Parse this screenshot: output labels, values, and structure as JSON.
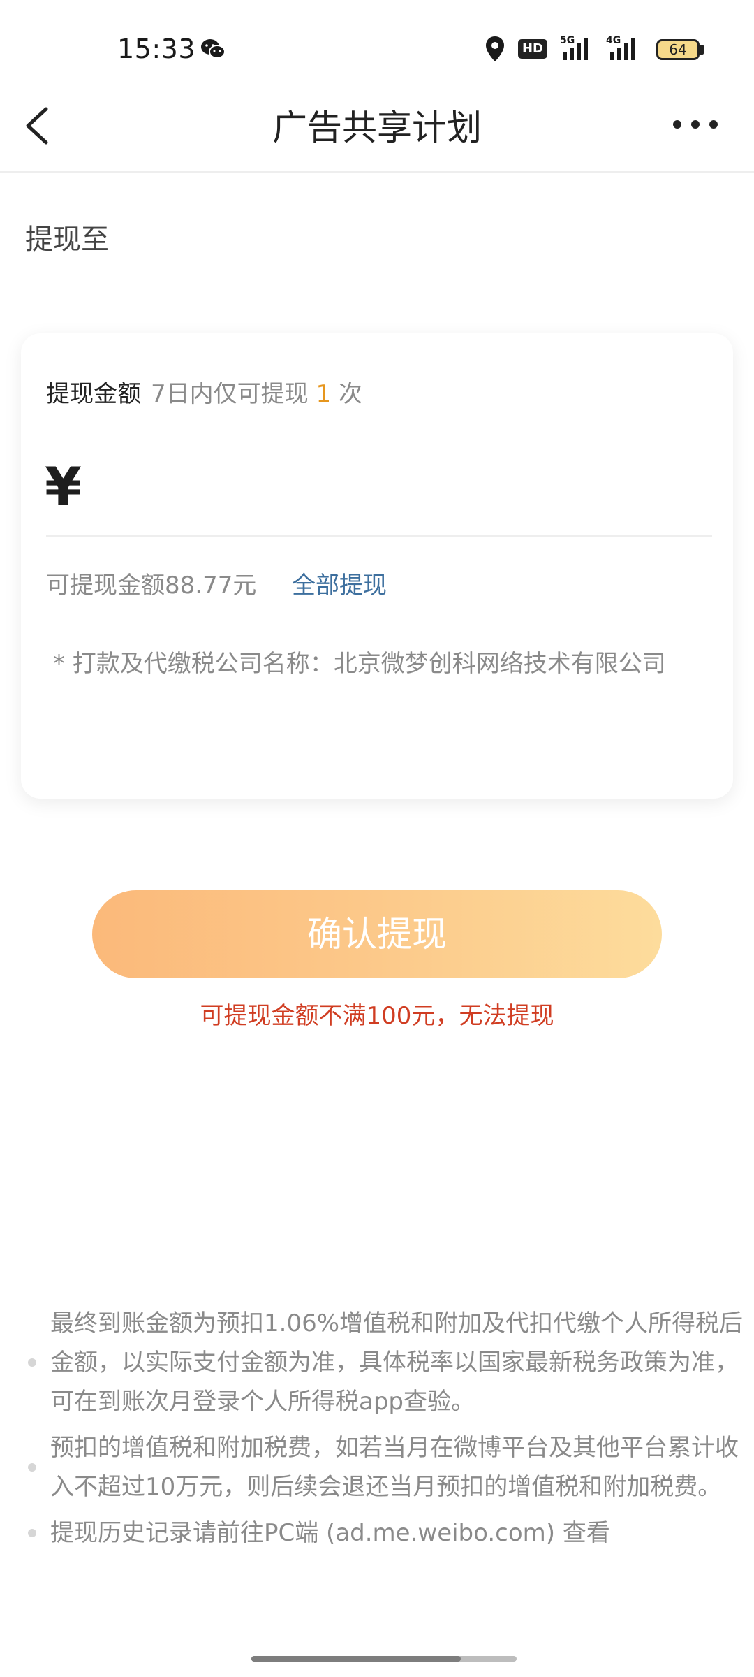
{
  "status_bar": {
    "time": "15:33",
    "hd_label": "HD",
    "signal1_label": "5G",
    "signal2_label": "4G",
    "battery": "64"
  },
  "nav": {
    "title": "广告共享计划"
  },
  "withdraw_to_label": "提现至",
  "card": {
    "amount_label": "提现金额",
    "limit_prefix": "7日内仅可提现",
    "limit_count": "1",
    "limit_suffix": "次",
    "currency_symbol": "¥",
    "available_text": "可提现金额88.77元",
    "withdraw_all": "全部提现",
    "company_note": "* 打款及代缴税公司名称：北京微梦创科网络技术有限公司"
  },
  "confirm_button": "确认提现",
  "error_text": "可提现金额不满100元，无法提现",
  "notes": [
    "最终到账金额为预扣1.06%增值税和附加及代扣代缴个人所得税后金额，以实际支付金额为准，具体税率以国家最新税务政策为准，可在到账次月登录个人所得税app查验。",
    "预扣的增值税和附加税费，如若当月在微博平台及其他平台累计收入不超过10万元，则后续会退还当月预扣的增值税和附加税费。",
    "提现历史记录请前往PC端 (ad.me.weibo.com) 查看"
  ],
  "colors": {
    "accent_orange": "#e6961e",
    "link_blue": "#3d6f9e",
    "error_red": "#d03d22",
    "button_gradient_start": "#fbb97a",
    "button_gradient_end": "#fddc9c"
  },
  "icons": [
    "wechat-icon",
    "location-icon",
    "signal-icon",
    "battery-icon",
    "back-arrow-icon",
    "more-icon"
  ]
}
